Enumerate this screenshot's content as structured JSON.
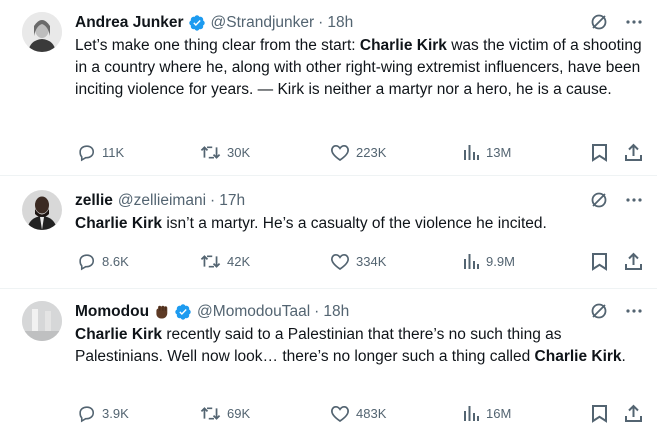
{
  "tweets": [
    {
      "name": "Andrea Junker",
      "handle": "@Strandjunker",
      "time": "18h",
      "verified": true,
      "text_segments": [
        {
          "text": "Let’s make one thing clear from the start: ",
          "bold": false
        },
        {
          "text": "Charlie Kirk",
          "bold": true
        },
        {
          "text": " was the victim of a shooting in a country where he, along with other right-wing extremist influencers, have been inciting violence for years. — Kirk is neither a martyr nor a hero, he is a cause.",
          "bold": false
        }
      ],
      "replies": "11K",
      "reposts": "30K",
      "likes": "223K",
      "views": "13M"
    },
    {
      "name": "zellie",
      "handle": "@zellieimani",
      "time": "17h",
      "verified": false,
      "text_segments": [
        {
          "text": "Charlie Kirk",
          "bold": true
        },
        {
          "text": " isn’t a martyr. He’s a casualty of the violence he incited.",
          "bold": false
        }
      ],
      "replies": "8.6K",
      "reposts": "42K",
      "likes": "334K",
      "views": "9.9M"
    },
    {
      "name": "Momodou",
      "handle": "@MomodouTaal",
      "time": "18h",
      "verified": true,
      "emoji": "raised-fist",
      "text_segments": [
        {
          "text": "Charlie Kirk",
          "bold": true
        },
        {
          "text": " recently said to a Palestinian that there’s no such thing as Palestinians. Well now look… there’s no longer such a thing called ",
          "bold": false
        },
        {
          "text": "Charlie Kirk",
          "bold": true
        },
        {
          "text": ".",
          "bold": false
        }
      ],
      "replies": "3.9K",
      "reposts": "69K",
      "likes": "483K",
      "views": "16M"
    }
  ],
  "colors": {
    "text": "#0f1419",
    "muted": "#536471",
    "verified": "#1d9bf0",
    "divider": "#eff3f4"
  },
  "icons": [
    "reply-icon",
    "repost-icon",
    "like-icon",
    "views-icon",
    "bookmark-icon",
    "share-icon",
    "grok-icon",
    "more-icon",
    "verified-icon"
  ]
}
